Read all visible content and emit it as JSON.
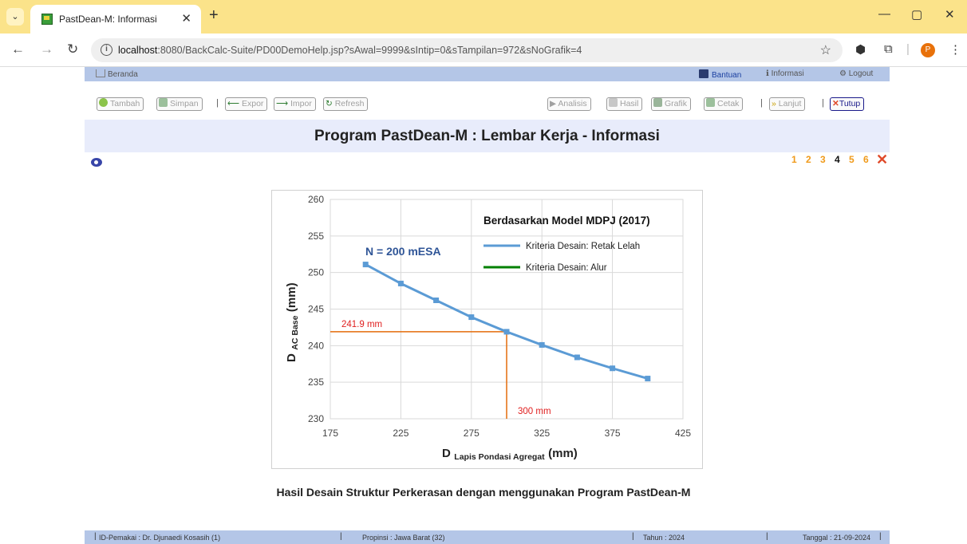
{
  "browser": {
    "tab_title": "PastDean-M: Informasi",
    "url_host": "localhost",
    "url_rest": ":8080/BackCalc-Suite/PD00DemoHelp.jsp?sAwal=9999&sIntip=0&sTampilan=972&sNoGrafik=4",
    "profile_initial": "P"
  },
  "nav": {
    "home": "Beranda",
    "help": "Bantuan",
    "info": "Informasi",
    "logout": "Logout"
  },
  "actions": {
    "tambah": "Tambah",
    "simpan": "Simpan",
    "expor": "Expor",
    "impor": "Impor",
    "refresh": "Refresh",
    "analisis": "Analisis",
    "hasil": "Hasil",
    "grafik": "Grafik",
    "cetak": "Cetak",
    "lanjut": "Lanjut",
    "tutup": "Tutup"
  },
  "page": {
    "title": "Program PastDean-M : Lembar Kerja - Informasi",
    "pages": [
      "1",
      "2",
      "3",
      "4",
      "5",
      "6"
    ],
    "current_page": "4",
    "caption": "Hasil Desain Struktur Perkerasan dengan menggunakan Program PastDean-M"
  },
  "footer": {
    "user": "ID-Pemakai : Dr. Djunaedi Kosasih (1)",
    "province": "Propinsi : Jawa Barat (32)",
    "year": "Tahun : 2024",
    "date": "Tanggal : 21-09-2024"
  },
  "chart_data": {
    "type": "line",
    "legend_title": "Berdasarkan Model MDPJ (2017)",
    "annotation": "N = 200 mESA",
    "xlabel_main": "D",
    "xlabel_sub": "Lapis Pondasi Agregat",
    "xlabel_unit": "(mm)",
    "ylabel_main": "D",
    "ylabel_sub": "AC Base",
    "ylabel_unit": "(mm)",
    "xlim": [
      175,
      425
    ],
    "ylim": [
      230,
      260
    ],
    "xticks": [
      175,
      225,
      275,
      325,
      375,
      425
    ],
    "yticks": [
      230,
      235,
      240,
      245,
      250,
      255,
      260
    ],
    "grid": true,
    "legend_placement": "top-right",
    "series": [
      {
        "name": "Kriteria Desain: Retak Lelah",
        "color": "#5b9bd5",
        "x": [
          200,
          225,
          250,
          275,
          300,
          325,
          350,
          375,
          400
        ],
        "y": [
          251.1,
          248.5,
          246.2,
          243.9,
          241.9,
          240.1,
          238.4,
          236.9,
          235.5
        ]
      },
      {
        "name": "Kriteria Desain: Alur",
        "color": "#008000",
        "x": [],
        "y": []
      }
    ],
    "design_point": {
      "x": 300,
      "y": 241.9,
      "x_label": "300 mm",
      "y_label": "241.9 mm",
      "color": "#e46c0a"
    }
  }
}
